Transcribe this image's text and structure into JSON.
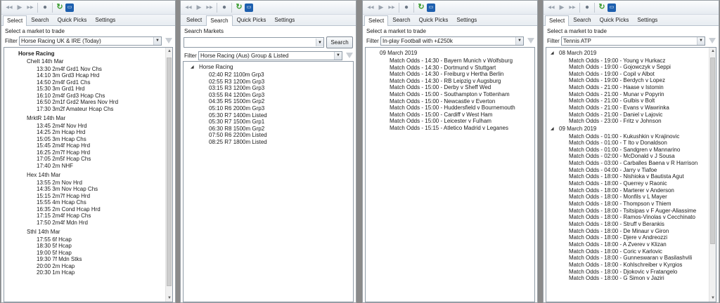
{
  "toolbar_icons": [
    "rewind-icon",
    "play-icon",
    "fast-forward-icon",
    "globe-icon",
    "refresh-icon",
    "terminal-icon"
  ],
  "tabs": [
    "Select",
    "Search",
    "Quick Picks",
    "Settings"
  ],
  "hint": "Select a market to trade",
  "filter_label": "Filter",
  "panel1": {
    "active_tab": 0,
    "filter_value": "Horse Racing UK & IRE (Today)",
    "root": "Horse Racing",
    "groups": [
      {
        "name": "Chelt 14th Mar",
        "items": [
          "13:30 2m4f Grd1 Nov Chs",
          "14:10 3m Grd3 Hcap Hrd",
          "14:50 2m4f Grd1 Chs",
          "15:30 3m Grd1 Hrd",
          "16:10 2m4f Grd3 Hcap Chs",
          "16:50 2m1f Grd2 Mares Nov Hrd",
          "17:30 3m2f Amateur Hcap Chs"
        ]
      },
      {
        "name": "MrktR 14th Mar",
        "items": [
          "13:45 2m4f Nov Hrd",
          "14:25 2m Hcap Hrd",
          "15:05 3m Hcap Chs",
          "15:45 2m4f Hcap Hrd",
          "16:25 2m7f Hcap Hrd",
          "17:05 2m5f Hcap Chs",
          "17:40 2m NHF"
        ]
      },
      {
        "name": "Hex 14th Mar",
        "items": [
          "13:55 2m Nov Hrd",
          "14:35 3m Nov Hcap Chs",
          "15:15 2m7f Hcap Hrd",
          "15:55 4m Hcap Chs",
          "16:35 2m Cond Hcap Hrd",
          "17:15 2m4f Hcap Chs",
          "17:50 2m4f Mdn Hrd"
        ]
      },
      {
        "name": "Sthl 14th Mar",
        "items": [
          "17:55 6f Hcap",
          "18:30 5f Hcap",
          "19:00 5f Hcap",
          "19:30 7f Mdn Stks",
          "20:00 2m Hcap",
          "20:30 1m Hcap"
        ]
      }
    ]
  },
  "panel2": {
    "active_tab": 1,
    "search_label": "Search Markets",
    "search_value": "",
    "search_button": "Search",
    "filter_value": "Horse Racing (Aus) Group & Listed",
    "root": "Horse Racing",
    "items": [
      "02:40 R2 1100m Grp3",
      "02:55 R3 1200m Grp3",
      "03:15 R3 1200m Grp3",
      "03:55 R4 1200m Grp3",
      "04:35 R5 1500m Grp2",
      "05:10 R6 2000m Grp3",
      "05:30 R7 1400m Listed",
      "05:30 R7 1500m Grp1",
      "06:30 R8 1500m Grp2",
      "07:50 R6 2200m Listed",
      "08:25 R7 1800m Listed"
    ]
  },
  "panel3": {
    "active_tab": 0,
    "filter_value": "In-play Football with +£250k",
    "date": "09 March 2019",
    "items": [
      "Match Odds - 14:30 - Bayern Munich v Wolfsburg",
      "Match Odds - 14:30 - Dortmund v Stuttgart",
      "Match Odds - 14:30 - Freiburg v Hertha Berlin",
      "Match Odds - 14:30 - RB Leipzig v Augsburg",
      "Match Odds - 15:00 - Derby v Sheff Wed",
      "Match Odds - 15:00 - Southampton v Tottenham",
      "Match Odds - 15:00 - Newcastle v Everton",
      "Match Odds - 15:00 - Huddersfield v Bournemouth",
      "Match Odds - 15:00 - Cardiff v West Ham",
      "Match Odds - 15:00 - Leicester v Fulham",
      "Match Odds - 15:15 - Atletico Madrid v Leganes"
    ]
  },
  "panel4": {
    "active_tab": 0,
    "filter_value": "Tennis ATP",
    "groups": [
      {
        "date": "08 March 2019",
        "items": [
          "Match Odds - 19:00 - Young v Hurkacz",
          "Match Odds - 19:00 - Gojowczyk v Seppi",
          "Match Odds - 19:00 - Copil v Albot",
          "Match Odds - 19:00 - Berdych v Lopez",
          "Match Odds - 21:00 - Haase v Istomin",
          "Match Odds - 21:00 - Munar v Popyrin",
          "Match Odds - 21:00 - Gulbis v Bolt",
          "Match Odds - 21:00 - Evans v Wawrinka",
          "Match Odds - 21:00 - Daniel v Lajovic",
          "Match Odds - 23:00 - Fritz v Johnson"
        ]
      },
      {
        "date": "09 March 2019",
        "items": [
          "Match Odds - 01:00 - Kukushkin v Krajinovic",
          "Match Odds - 01:00 - T Ito v Donaldson",
          "Match Odds - 01:00 - Sandgren v Mannarino",
          "Match Odds - 02:00 - McDonald v J Sousa",
          "Match Odds - 03:00 - Carballes Baena v R Harrison",
          "Match Odds - 04:00 - Jarry v Tiafoe",
          "Match Odds - 18:00 - Nishioka v Bautista Agut",
          "Match Odds - 18:00 - Querrey v Raonic",
          "Match Odds - 18:00 - Marterer v Anderson",
          "Match Odds - 18:00 - Monfils v L Mayer",
          "Match Odds - 18:00 - Thompson v Thiem",
          "Match Odds - 18:00 - Tsitsipas v F Auger-Aliassime",
          "Match Odds - 18:00 - Ramos-Vinolas v Cecchinato",
          "Match Odds - 18:00 - Struff v Berankis",
          "Match Odds - 18:00 - De Minaur v Giron",
          "Match Odds - 18:00 - Djere v Andreozzi",
          "Match Odds - 18:00 - A Zverev v Klizan",
          "Match Odds - 18:00 - Coric v Karlovic",
          "Match Odds - 18:00 - Gunneswaran v Basilashvili",
          "Match Odds - 18:00 - Kohlschreiber v Kyrgios",
          "Match Odds - 18:00 - Djokovic v Fratangelo",
          "Match Odds - 18:00 - G Simon v Jaziri"
        ]
      }
    ]
  }
}
